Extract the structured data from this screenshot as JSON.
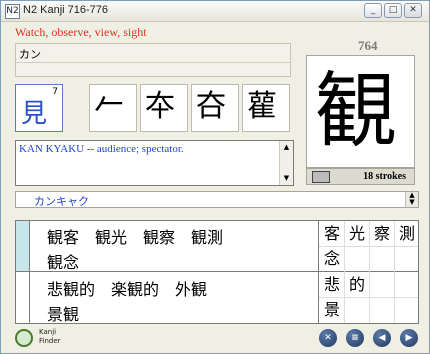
{
  "window": {
    "title": "N2 Kanji 716-776",
    "icon_text": "N2",
    "controls": {
      "minimize": "_",
      "maximize": "□",
      "close": "✕"
    }
  },
  "meaning": "Watch, observe, view, sight",
  "kanji_number": "764",
  "reading": "カン",
  "radical": {
    "glyph": "見",
    "stroke_count": "7"
  },
  "stroke_order": [
    "⺈",
    "⺮",
    "㒳",
    "⿷"
  ],
  "stroke_order_display": [
    "𠂉",
    "夲",
    "夻",
    "雚"
  ],
  "kanji": "観",
  "strokes_label": "18 strokes",
  "english_example": "KAN KYAKU -- audience; spectator.",
  "kana_example": "カンキャク",
  "compounds": {
    "row1a": "観客　観光　観察　観測",
    "row1b": "観念",
    "row2a": "悲観的　楽観的　外観",
    "row2b": "景観"
  },
  "char_grid": [
    [
      "客",
      "光",
      "察",
      "測"
    ],
    [
      "念",
      "",
      "",
      ""
    ],
    [
      "悲",
      "的",
      "",
      ""
    ],
    [
      "景",
      "",
      "",
      ""
    ]
  ],
  "kanji_finder": {
    "line1": "Kanji",
    "line2": "Finder"
  },
  "nav_buttons": {
    "close": "✕",
    "list": "≡",
    "prev": "◀",
    "next": "▶"
  },
  "colors": {
    "meaning": "#e03020",
    "blue_text": "#2244cc",
    "selected_cell": "#c6e6ea"
  }
}
